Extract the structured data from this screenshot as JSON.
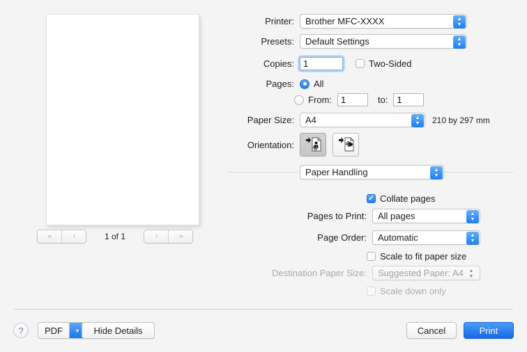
{
  "preview": {
    "page_indicator": "1 of 1",
    "nav": {
      "first_label": "«",
      "prev_label": "‹",
      "next_label": "›",
      "last_label": "»"
    }
  },
  "settings": {
    "printer": {
      "label": "Printer:",
      "value": "Brother MFC-XXXX"
    },
    "presets": {
      "label": "Presets:",
      "value": "Default Settings"
    },
    "copies": {
      "label": "Copies:",
      "value": "1",
      "two_sided_label": "Two-Sided",
      "two_sided_checked": false
    },
    "pages": {
      "label": "Pages:",
      "all_label": "All",
      "all_selected": true,
      "from_label": "From:",
      "from_value": "1",
      "to_label": "to:",
      "to_value": "1"
    },
    "paper_size": {
      "label": "Paper Size:",
      "value": "A4",
      "dimensions": "210 by 297 mm"
    },
    "orientation": {
      "label": "Orientation:",
      "portrait_name": "portrait",
      "landscape_name": "landscape",
      "selected": "portrait"
    },
    "section": {
      "value": "Paper Handling"
    },
    "collate": {
      "label": "Collate pages",
      "checked": true
    },
    "pages_to_print": {
      "label": "Pages to Print:",
      "value": "All pages"
    },
    "page_order": {
      "label": "Page Order:",
      "value": "Automatic"
    },
    "scale_to_fit": {
      "label": "Scale to fit paper size",
      "checked": false
    },
    "destination_paper_size": {
      "label": "Destination Paper Size:",
      "value": "Suggested Paper: A4",
      "disabled": true
    },
    "scale_down_only": {
      "label": "Scale down only",
      "checked": false,
      "disabled": true
    }
  },
  "bottom_bar": {
    "help_label": "?",
    "pdf_label": "PDF",
    "pdf_arrow": "▾",
    "hide_details_label": "Hide Details",
    "cancel_label": "Cancel",
    "print_label": "Print"
  },
  "colors": {
    "accent_blue": "#2b7cef",
    "window_bg": "#f4f4f4",
    "text": "#1c1c1c",
    "disabled_text": "#a9a9a9"
  }
}
